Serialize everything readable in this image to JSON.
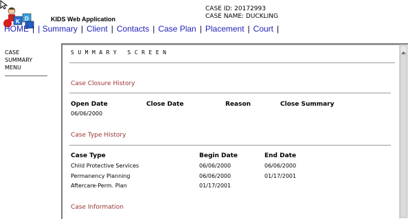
{
  "header": {
    "app_title": "KIDS Web Application",
    "case_id": "CASE ID: 20172993",
    "case_name": "CASE NAME: DUCKLING"
  },
  "nav": {
    "items": [
      {
        "label": "HOME",
        "sep": "|"
      },
      {
        "label": "| Summary",
        "sep": "|"
      },
      {
        "label": "Client",
        "sep": "|"
      },
      {
        "label": "Contacts",
        "sep": "|"
      },
      {
        "label": "Case Plan",
        "sep": "|"
      },
      {
        "label": "Placement",
        "sep": "|"
      },
      {
        "label": "Court",
        "sep": "|"
      }
    ]
  },
  "side_menu": {
    "lines": [
      "CASE",
      "SUMMARY",
      "MENU"
    ]
  },
  "main": {
    "title": "SUMMARY SCREEN",
    "closure": {
      "title": "Case Closure History",
      "headers": [
        "Open Date",
        "Close Date",
        "Reason",
        "Close Summary"
      ],
      "rows": [
        [
          "06/06/2000",
          "",
          "",
          ""
        ]
      ]
    },
    "type_history": {
      "title": "Case Type History",
      "headers": [
        "Case Type",
        "Begin Date",
        "End Date"
      ],
      "rows": [
        [
          "Child Protective Services",
          "06/06/2000",
          "06/06/2000"
        ],
        [
          "Permanency Planning",
          "06/06/2000",
          "01/17/2001"
        ],
        [
          "Aftercare-Perm. Plan",
          "01/17/2001",
          ""
        ]
      ]
    },
    "case_information": {
      "title": "Case Information"
    }
  },
  "colors": {
    "nav_link": "#2222b8",
    "section_title": "#993333"
  }
}
